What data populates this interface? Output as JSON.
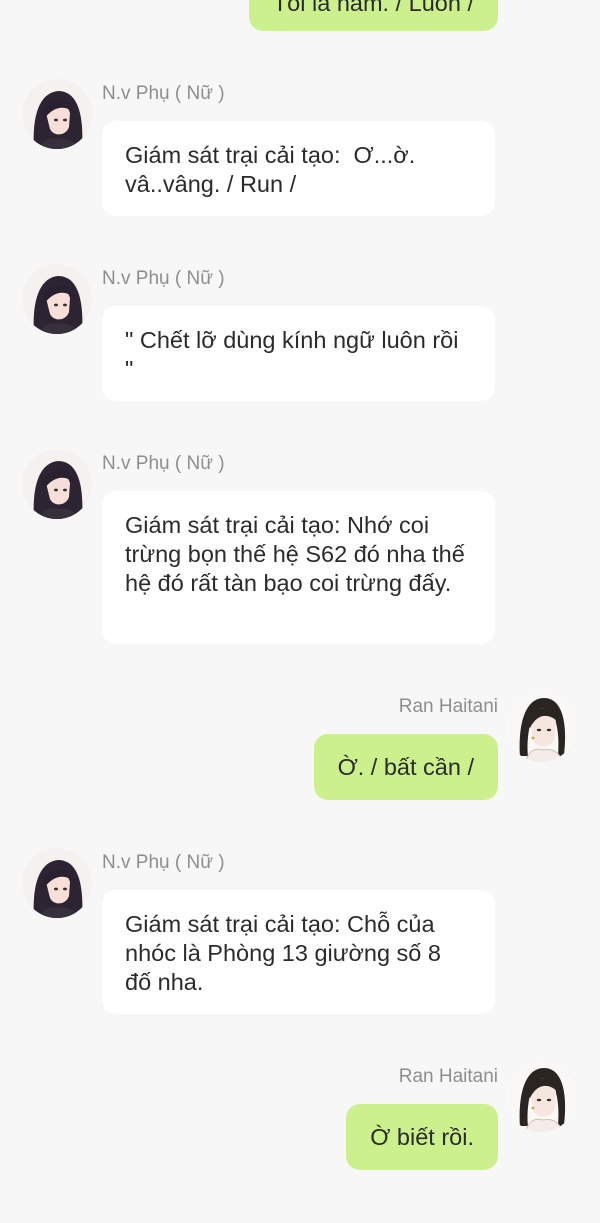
{
  "app": {
    "colors": {
      "background": "#f7f7f7",
      "incoming_bubble": "#ffffff",
      "outgoing_bubble": "#ccf08c",
      "sender_name": "#8e8e8e",
      "message_text": "#2b2b2b"
    }
  },
  "partial_top_message": {
    "text": "Tôi là nam. / Luôn /"
  },
  "messages": [
    {
      "side": "left",
      "sender": "N.v Phụ ( Nữ )",
      "avatar": "dark-hair-girl-avatar",
      "text": "Giám sát trại cải tạo:  Ơ...ờ. vâ..vâng. / Run /"
    },
    {
      "side": "left",
      "sender": "N.v Phụ ( Nữ )",
      "avatar": "dark-hair-girl-avatar",
      "text": "\" Chết lỡ dùng kính ngữ luôn rồi \""
    },
    {
      "side": "left",
      "sender": "N.v Phụ ( Nữ )",
      "avatar": "dark-hair-girl-avatar",
      "text": "Giám sát trại cải tạo: Nhớ coi trừng bọn thế hệ S62 đó nha thế hệ đó rất tàn bạo coi trừng đấy."
    },
    {
      "side": "right",
      "sender": "Ran Haitani",
      "avatar": "braided-hair-man-avatar",
      "text": "Ờ. / bất cần /"
    },
    {
      "side": "left",
      "sender": "N.v Phụ ( Nữ )",
      "avatar": "dark-hair-girl-avatar",
      "text": "Giám sát trại cải tạo: Chỗ của nhóc là Phòng 13 giường số 8 đố nha."
    },
    {
      "side": "right",
      "sender": "Ran Haitani",
      "avatar": "braided-hair-man-avatar",
      "text": "Ờ biết rồi."
    }
  ]
}
